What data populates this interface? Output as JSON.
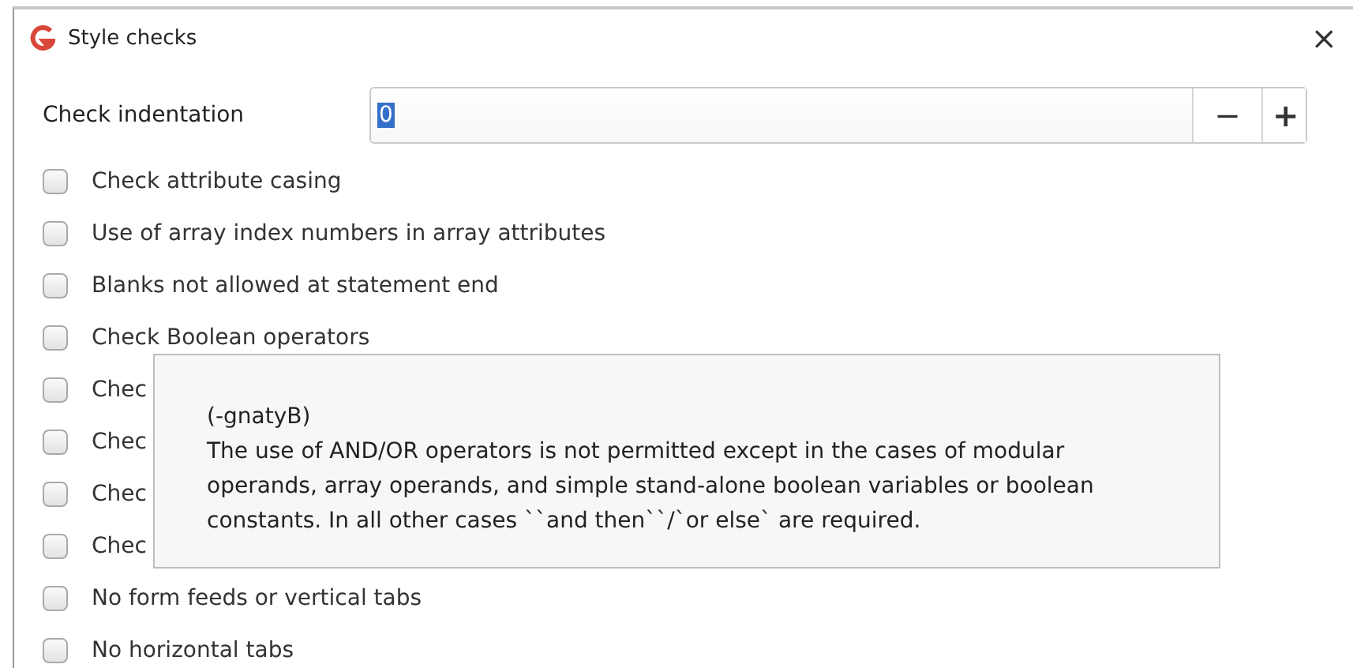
{
  "window": {
    "title": "Style checks",
    "close": "×"
  },
  "indentation": {
    "label": "Check indentation",
    "value": "0",
    "value_selected": true,
    "decrement": "−",
    "increment": "+"
  },
  "options": [
    {
      "label": "Check attribute casing",
      "checked": false
    },
    {
      "label": "Use of array index numbers in array attributes",
      "checked": false
    },
    {
      "label": "Blanks not allowed at statement end",
      "checked": false
    },
    {
      "label": "Check Boolean operators",
      "checked": false
    },
    {
      "label": "Chec",
      "checked": false
    },
    {
      "label": "Chec",
      "checked": false
    },
    {
      "label": "Chec",
      "checked": false
    },
    {
      "label": "Chec",
      "checked": false
    },
    {
      "label": "No form feeds or vertical tabs",
      "checked": false
    },
    {
      "label": "No horizontal tabs",
      "checked": false
    }
  ],
  "tooltip": {
    "switch": "(-gnatyB)",
    "text": "The use of AND/OR operators is not permitted except in the cases of modular operands, array operands, and simple stand-alone boolean variables or boolean constants. In all other cases ``and then``/`or else` are required."
  }
}
